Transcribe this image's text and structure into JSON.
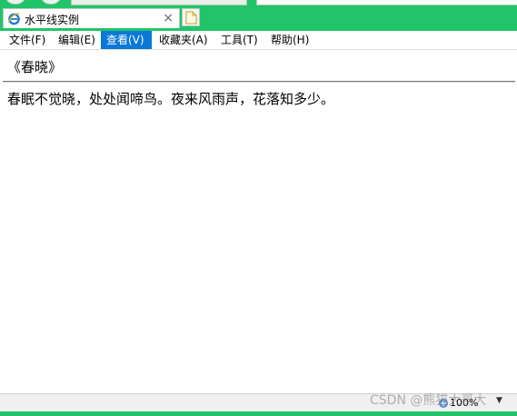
{
  "tab": {
    "title": "水平线实例",
    "close_glyph": "×",
    "icon": "ie-logo-icon"
  },
  "menu": {
    "items": [
      {
        "label": "文件(F)",
        "active": false
      },
      {
        "label": "编辑(E)",
        "active": false
      },
      {
        "label": "查看(V)",
        "active": true
      },
      {
        "label": "收藏夹(A)",
        "active": false
      },
      {
        "label": "工具(T)",
        "active": false
      },
      {
        "label": "帮助(H)",
        "active": false
      }
    ]
  },
  "content": {
    "heading": "《春晓》",
    "poem": "春眠不觉晓，处处闻啼鸟。夜来风雨声，花落知多少。"
  },
  "status": {
    "zoom": "100%",
    "dropdown_glyph": "▼"
  },
  "watermark": "CSDN @熊猫大哥大",
  "colors": {
    "chrome_green": "#21c468",
    "menu_active": "#0a78d7"
  }
}
